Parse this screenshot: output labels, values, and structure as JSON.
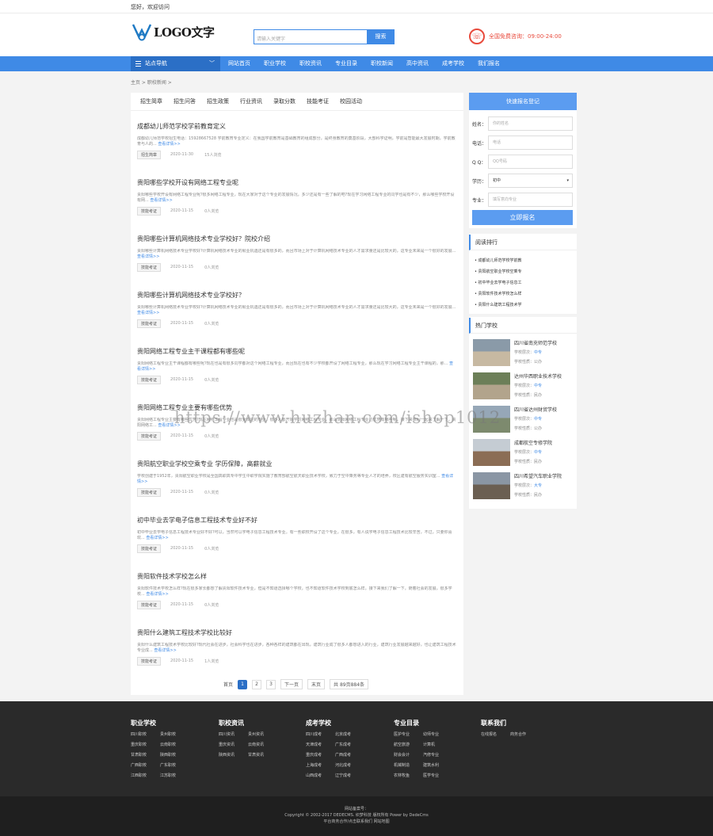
{
  "topbar": {
    "greeting": "您好，欢迎访问"
  },
  "header": {
    "logo_text": "LOGO文字",
    "search_placeholder": "请输入关键字",
    "search_button": "搜索",
    "hotline": "全国免费咨询：09:00-24:00"
  },
  "nav": {
    "site_nav": "站点导航",
    "items": [
      "网站首页",
      "职业学校",
      "职校资讯",
      "专业目录",
      "职校新闻",
      "高中资讯",
      "成考学校",
      "我们报名"
    ]
  },
  "breadcrumb": "主页 > 职校新闻 >",
  "tabs": [
    "招生简章",
    "招生问答",
    "招生政策",
    "行业资讯",
    "录取分数",
    "技能考证",
    "校园活动"
  ],
  "articles": [
    {
      "title": "成都幼儿师范学校学前教育定义",
      "desc": "成都幼儿师范学校招生电话：15928667528 学前教育专业定义：在我国学前教育是基础教育的组成部分，是终身教育的奠基阶段，大部科学证明，学前是智能最大发展时期，学前教育与人的...",
      "more": "查看详情>>",
      "tag": "招生简章",
      "date": "2020-11-30",
      "views": "15人浏览"
    },
    {
      "title": "贵阳哪些学校开设有网络工程专业呢",
      "desc": "贵阳哪些学校开设有网络工程专业呢?很多网络工程专业，现在大家对于这个专业的发展情况，多少还是有一些了解的吧?现在学习网络工程专业的同学也是有不少，那么哪些学校开设有网...",
      "more": "查看详情>>",
      "tag": "技能考证",
      "date": "2020-11-15",
      "views": "0人浏览"
    },
    {
      "title": "贵阳哪些计算机网络技术专业学校好？院校介绍",
      "desc": "贵阳哪些计算机网络技术专业学校好?计算机网络技术专业的就业机遇还是有很多的，而且市场上对于计算机网络技术专业的人才需求量还是比较大的，这专业未来是一个很好的发展...",
      "more": "查看详情>>",
      "tag": "技能考证",
      "date": "2020-11-15",
      "views": "0人浏览"
    },
    {
      "title": "贵阳哪些计算机网络技术专业学校好？",
      "desc": "贵阳哪些计算机网络技术专业学校好?计算机网络技术专业的就业机遇还是有很多的，而且市场上对于计算机网络技术专业的人才需求量还是比较大的，这专业未来是一个很好的发展...",
      "more": "查看详情>>",
      "tag": "技能考证",
      "date": "2020-11-15",
      "views": "0人浏览"
    },
    {
      "title": "贵阳网络工程专业主干课程都有哪些呢",
      "desc": "贵阳网络工程专业主干课程都有哪些呢?现在也是有很多同学都对这个网络工程专业，而且现在也有不少学校都开设了网络工程专业，那么现在学习网络工程专业主干课程的，那...",
      "more": "查看详情>>",
      "tag": "技能考证",
      "date": "2020-11-15",
      "views": "0人浏览"
    },
    {
      "title": "贵阳网络工程专业主要有哪些优势",
      "desc": "贵阳网络工程专业主要有哪些优势?现在网络工程专业也是很受欢迎的专业，很多人都开始学习网络工程专业，那么贵阳网络工程专业的优势有哪些呢，接下来我们一起来了解一下，贵阳网络工...",
      "more": "查看详情>>",
      "tag": "技能考证",
      "date": "2020-11-15",
      "views": "0人浏览"
    },
    {
      "title": "贵阳航空职业学校空乘专业 学历保障，高薪就业",
      "desc": "学校创建于1952年，贵阳航空职业学校是全国高职高专中学生中职学院实施了教育部航空航天职业技术学校，致力于空中乘务等专业人才的培养，校区建有航空服务实训室...",
      "more": "查看详情>>",
      "tag": "技能考证",
      "date": "2020-11-15",
      "views": "0人浏览"
    },
    {
      "title": "初中毕业去学电子信息工程技术专业好不好",
      "desc": "初中毕业去学电子信息工程技术专业好不好?可以，当然可以学电子信息工程技术专业。有一些职校开设了这个专业，在很多，有人说学电子信息工程技术比较辛苦，不过，只要你喜欢...",
      "more": "查看详情>>",
      "tag": "技能考证",
      "date": "2020-11-15",
      "views": "0人浏览"
    },
    {
      "title": "贵阳软件技术学校怎么样",
      "desc": "贵阳软件技术学校怎么样?现在很多家长都想了解贵阳软件技术专业，但是不知道选择哪个学校，也不知道软件技术学校到底怎么样，接下来我们了解一下，随着社会的发展，很多学校...",
      "more": "查看详情>>",
      "tag": "技能考证",
      "date": "2020-11-15",
      "views": "0人浏览"
    },
    {
      "title": "贵阳什么建筑工程技术学校比较好",
      "desc": "贵阳什么建筑工程技术学校比较好?现代社会在进步，社会科学也在进步，各种各样的建筑都在出现，建筑行业成了很多人都想进入的行业，建筑行业发展越来越好，也让建筑工程技术专业成...",
      "more": "查看详情>>",
      "tag": "技能考证",
      "date": "2020-11-15",
      "views": "1人浏览"
    }
  ],
  "pager": {
    "first": "首页",
    "pages": [
      "1",
      "2",
      "3"
    ],
    "next": "下一页",
    "last": "末页",
    "total": "共 89页884条"
  },
  "quick": {
    "title": "快速报名登记",
    "fields": [
      {
        "label": "姓名：",
        "placeholder": "你的姓名"
      },
      {
        "label": "电话：",
        "placeholder": "电话"
      },
      {
        "label": "Q Q：",
        "placeholder": "QQ号码"
      },
      {
        "label": "学历：",
        "placeholder": "初中"
      },
      {
        "label": "专业：",
        "placeholder": "填写意向专业"
      }
    ],
    "submit": "立即报名"
  },
  "rank": {
    "title": "阅读排行",
    "items": [
      "成都幼儿师范学校学前教",
      "贵阳航空职业学校空乘专",
      "初中毕业去学电子信息工",
      "贵阳软件技术学校怎么样",
      "贵阳什么建筑工程技术学"
    ]
  },
  "hot": {
    "title": "热门学校",
    "schools": [
      {
        "name": "四川省南充师范学校",
        "l1": "学校层次：",
        "lvl": "中专",
        "l2": "学校性质：公办"
      },
      {
        "name": "达州华西职业技术学校",
        "l1": "学校层次：",
        "lvl": "中专",
        "l2": "学校性质：民办"
      },
      {
        "name": "四川省达州财贸学校",
        "l1": "学校层次：",
        "lvl": "中专",
        "l2": "学校性质：公办"
      },
      {
        "name": "成都航空专修学院",
        "l1": "学校层次：",
        "lvl": "中专",
        "l2": "学校性质：民办"
      },
      {
        "name": "四川希望汽车职业学院",
        "l1": "学校层次：",
        "lvl": "大专",
        "l2": "学校性质：民办"
      }
    ]
  },
  "footer": {
    "cols": [
      {
        "title": "职业学校",
        "links": [
          "四川职校",
          "贵州职校",
          "重庆职校",
          "云南职校",
          "甘肃职校",
          "陕西职校",
          "广西职校",
          "广东职校",
          "江西职校",
          "江苏职校"
        ]
      },
      {
        "title": "职校资讯",
        "links": [
          "四川资讯",
          "贵州资讯",
          "重庆资讯",
          "云南资讯",
          "陕西资讯",
          "甘肃资讯"
        ]
      },
      {
        "title": "成考学校",
        "links": [
          "四川成考",
          "北京成考",
          "天津成考",
          "广东成考",
          "重庆成考",
          "广西成考",
          "上海成考",
          "河北成考",
          "山西成考",
          "辽宁成考"
        ]
      },
      {
        "title": "专业目录",
        "links": [
          "医护专业",
          "幼师专业",
          "航空旅游",
          "计算机",
          "财会会计",
          "汽修专业",
          "机械制造",
          "建筑水利",
          "农林牧鱼",
          "医学专业"
        ]
      },
      {
        "title": "联系我们",
        "links": [
          "在线报名",
          "商务合作"
        ]
      }
    ],
    "copy1": "网站备案号：",
    "copy2": "Copyright © 2002-2017 DEDECMS. 织梦科技 版权所有  Power by DedeCms",
    "copy3": "平台商务合作/点击联系我们  网站地图"
  },
  "watermark": "https://www.huzhan.com/ishop1012"
}
